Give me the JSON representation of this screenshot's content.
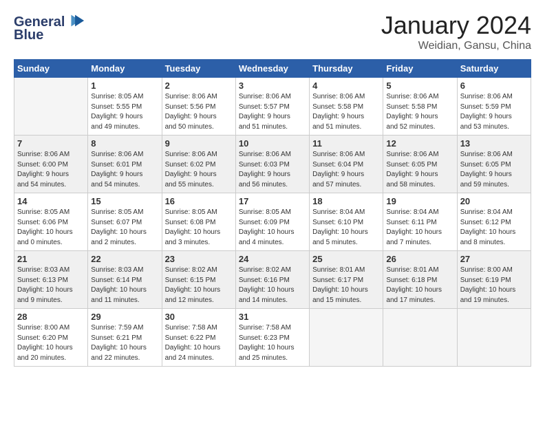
{
  "logo": {
    "line1": "General",
    "line2": "Blue"
  },
  "title": "January 2024",
  "subtitle": "Weidian, Gansu, China",
  "calendar": {
    "headers": [
      "Sunday",
      "Monday",
      "Tuesday",
      "Wednesday",
      "Thursday",
      "Friday",
      "Saturday"
    ],
    "rows": [
      [
        {
          "num": "",
          "info": ""
        },
        {
          "num": "1",
          "info": "Sunrise: 8:05 AM\nSunset: 5:55 PM\nDaylight: 9 hours\nand 49 minutes."
        },
        {
          "num": "2",
          "info": "Sunrise: 8:06 AM\nSunset: 5:56 PM\nDaylight: 9 hours\nand 50 minutes."
        },
        {
          "num": "3",
          "info": "Sunrise: 8:06 AM\nSunset: 5:57 PM\nDaylight: 9 hours\nand 51 minutes."
        },
        {
          "num": "4",
          "info": "Sunrise: 8:06 AM\nSunset: 5:58 PM\nDaylight: 9 hours\nand 51 minutes."
        },
        {
          "num": "5",
          "info": "Sunrise: 8:06 AM\nSunset: 5:58 PM\nDaylight: 9 hours\nand 52 minutes."
        },
        {
          "num": "6",
          "info": "Sunrise: 8:06 AM\nSunset: 5:59 PM\nDaylight: 9 hours\nand 53 minutes."
        }
      ],
      [
        {
          "num": "7",
          "info": "Sunrise: 8:06 AM\nSunset: 6:00 PM\nDaylight: 9 hours\nand 54 minutes."
        },
        {
          "num": "8",
          "info": "Sunrise: 8:06 AM\nSunset: 6:01 PM\nDaylight: 9 hours\nand 54 minutes."
        },
        {
          "num": "9",
          "info": "Sunrise: 8:06 AM\nSunset: 6:02 PM\nDaylight: 9 hours\nand 55 minutes."
        },
        {
          "num": "10",
          "info": "Sunrise: 8:06 AM\nSunset: 6:03 PM\nDaylight: 9 hours\nand 56 minutes."
        },
        {
          "num": "11",
          "info": "Sunrise: 8:06 AM\nSunset: 6:04 PM\nDaylight: 9 hours\nand 57 minutes."
        },
        {
          "num": "12",
          "info": "Sunrise: 8:06 AM\nSunset: 6:05 PM\nDaylight: 9 hours\nand 58 minutes."
        },
        {
          "num": "13",
          "info": "Sunrise: 8:06 AM\nSunset: 6:05 PM\nDaylight: 9 hours\nand 59 minutes."
        }
      ],
      [
        {
          "num": "14",
          "info": "Sunrise: 8:05 AM\nSunset: 6:06 PM\nDaylight: 10 hours\nand 0 minutes."
        },
        {
          "num": "15",
          "info": "Sunrise: 8:05 AM\nSunset: 6:07 PM\nDaylight: 10 hours\nand 2 minutes."
        },
        {
          "num": "16",
          "info": "Sunrise: 8:05 AM\nSunset: 6:08 PM\nDaylight: 10 hours\nand 3 minutes."
        },
        {
          "num": "17",
          "info": "Sunrise: 8:05 AM\nSunset: 6:09 PM\nDaylight: 10 hours\nand 4 minutes."
        },
        {
          "num": "18",
          "info": "Sunrise: 8:04 AM\nSunset: 6:10 PM\nDaylight: 10 hours\nand 5 minutes."
        },
        {
          "num": "19",
          "info": "Sunrise: 8:04 AM\nSunset: 6:11 PM\nDaylight: 10 hours\nand 7 minutes."
        },
        {
          "num": "20",
          "info": "Sunrise: 8:04 AM\nSunset: 6:12 PM\nDaylight: 10 hours\nand 8 minutes."
        }
      ],
      [
        {
          "num": "21",
          "info": "Sunrise: 8:03 AM\nSunset: 6:13 PM\nDaylight: 10 hours\nand 9 minutes."
        },
        {
          "num": "22",
          "info": "Sunrise: 8:03 AM\nSunset: 6:14 PM\nDaylight: 10 hours\nand 11 minutes."
        },
        {
          "num": "23",
          "info": "Sunrise: 8:02 AM\nSunset: 6:15 PM\nDaylight: 10 hours\nand 12 minutes."
        },
        {
          "num": "24",
          "info": "Sunrise: 8:02 AM\nSunset: 6:16 PM\nDaylight: 10 hours\nand 14 minutes."
        },
        {
          "num": "25",
          "info": "Sunrise: 8:01 AM\nSunset: 6:17 PM\nDaylight: 10 hours\nand 15 minutes."
        },
        {
          "num": "26",
          "info": "Sunrise: 8:01 AM\nSunset: 6:18 PM\nDaylight: 10 hours\nand 17 minutes."
        },
        {
          "num": "27",
          "info": "Sunrise: 8:00 AM\nSunset: 6:19 PM\nDaylight: 10 hours\nand 19 minutes."
        }
      ],
      [
        {
          "num": "28",
          "info": "Sunrise: 8:00 AM\nSunset: 6:20 PM\nDaylight: 10 hours\nand 20 minutes."
        },
        {
          "num": "29",
          "info": "Sunrise: 7:59 AM\nSunset: 6:21 PM\nDaylight: 10 hours\nand 22 minutes."
        },
        {
          "num": "30",
          "info": "Sunrise: 7:58 AM\nSunset: 6:22 PM\nDaylight: 10 hours\nand 24 minutes."
        },
        {
          "num": "31",
          "info": "Sunrise: 7:58 AM\nSunset: 6:23 PM\nDaylight: 10 hours\nand 25 minutes."
        },
        {
          "num": "",
          "info": ""
        },
        {
          "num": "",
          "info": ""
        },
        {
          "num": "",
          "info": ""
        }
      ]
    ]
  }
}
